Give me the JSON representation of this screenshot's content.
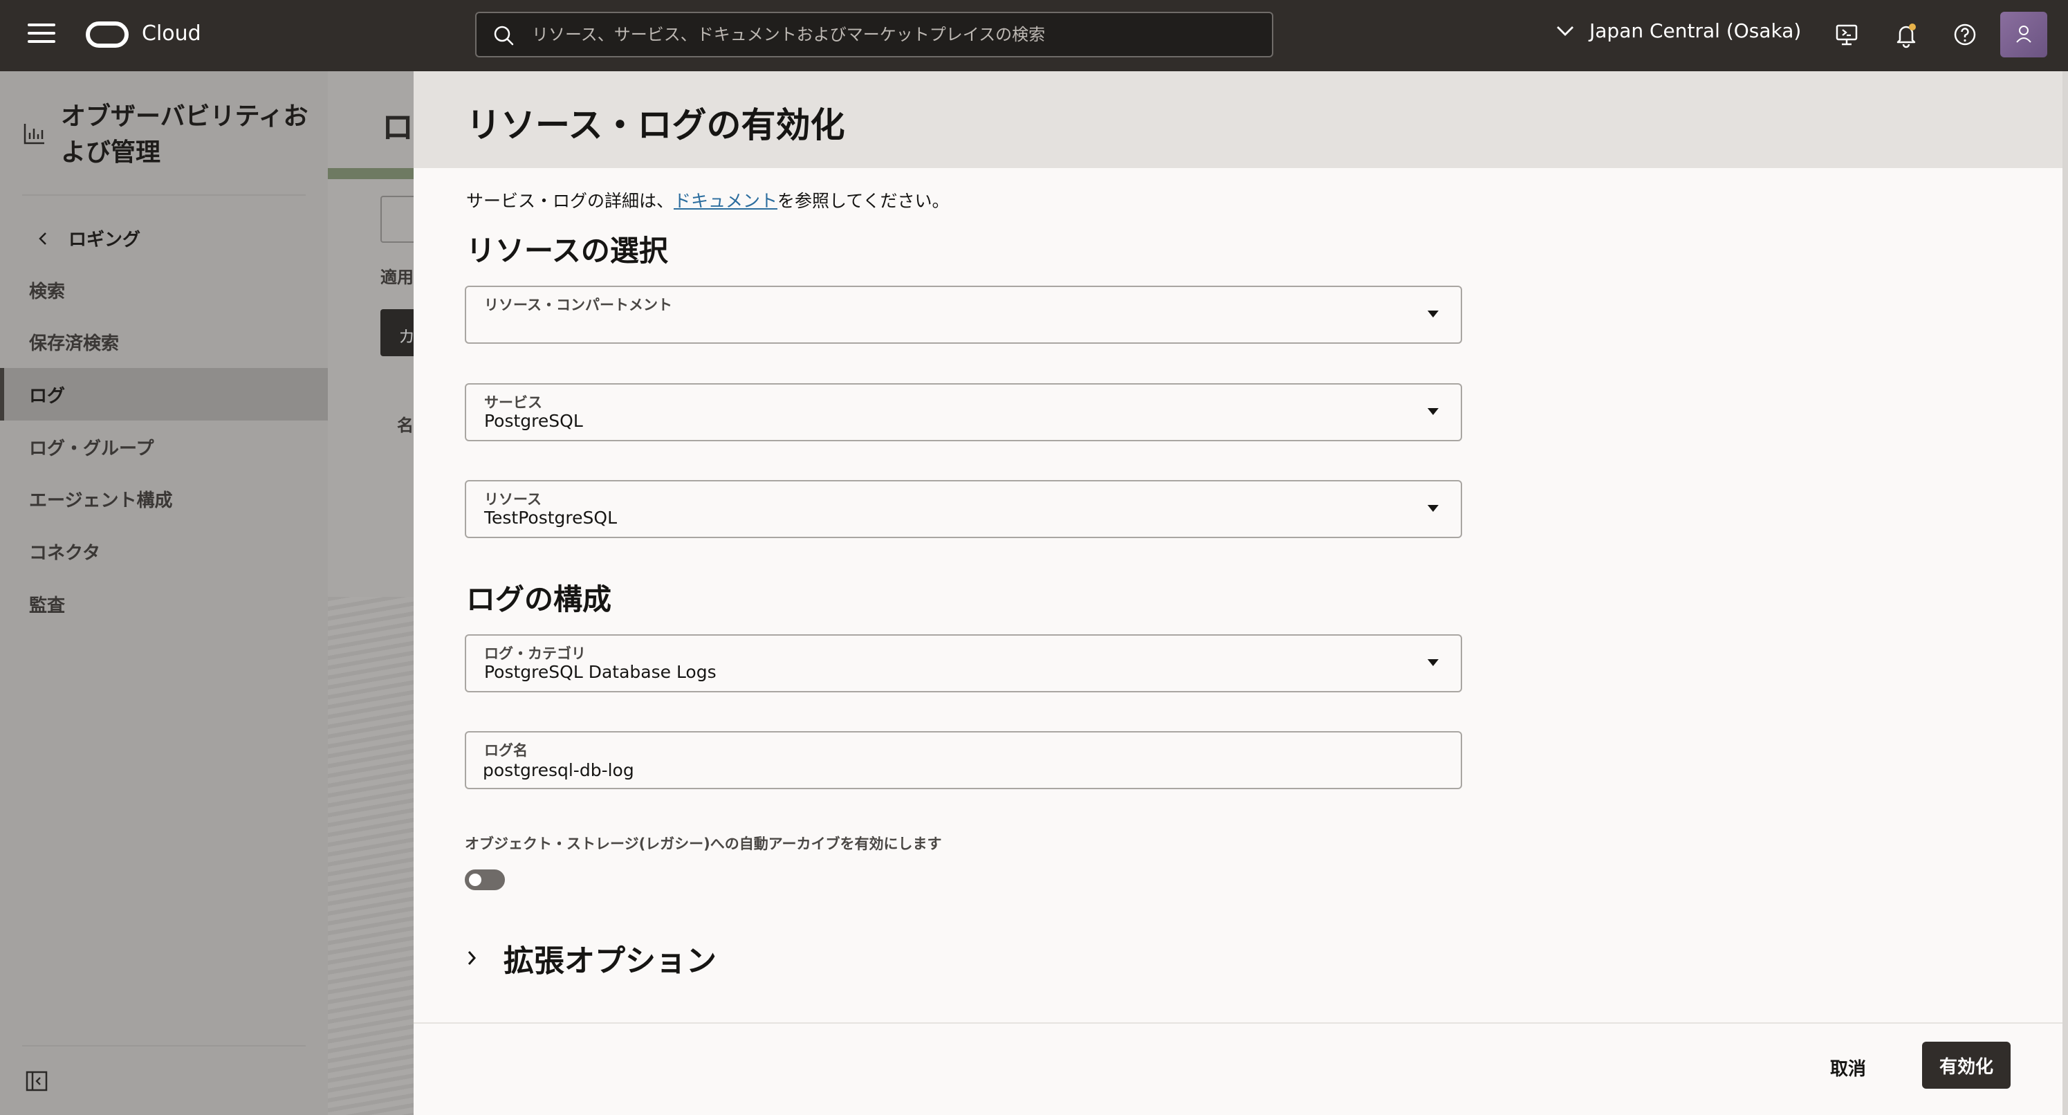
{
  "header": {
    "brand": "Cloud",
    "search_placeholder": "リソース、サービス、ドキュメントおよびマーケットプレイスの検索",
    "region": "Japan Central (Osaka)"
  },
  "sidebar": {
    "title": "オブザーバビリティおよび管理",
    "back_label": "ロギング",
    "items": [
      {
        "label": "検索"
      },
      {
        "label": "保存済検索"
      },
      {
        "label": "ログ"
      },
      {
        "label": "ログ・グループ"
      },
      {
        "label": "エージェント構成"
      },
      {
        "label": "コネクタ"
      },
      {
        "label": "監査"
      }
    ]
  },
  "background_page": {
    "title": "ロ",
    "label": "適用",
    "button": "カ",
    "column": "名"
  },
  "drawer": {
    "title": "リソース・ログの有効化",
    "intro_prefix": "サービス・ログの詳細は、",
    "intro_link": "ドキュメント",
    "intro_suffix": "を参照してください。",
    "resource_section": "リソースの選択",
    "fields": {
      "compartment": {
        "label": "リソース・コンパートメント",
        "value": ""
      },
      "service": {
        "label": "サービス",
        "value": "PostgreSQL"
      },
      "resource": {
        "label": "リソース",
        "value": "TestPostgreSQL"
      }
    },
    "log_section": "ログの構成",
    "log_category": {
      "label": "ログ・カテゴリ",
      "value": "PostgreSQL Database Logs"
    },
    "log_name": {
      "label": "ログ名",
      "value": "postgresql-db-log"
    },
    "archive_toggle_label": "オブジェクト・ストレージ(レガシー)への自動アーカイブを有効にします",
    "archive_toggle_on": false,
    "advanced_options": "拡張オプション",
    "cancel": "取消",
    "submit": "有効化"
  }
}
